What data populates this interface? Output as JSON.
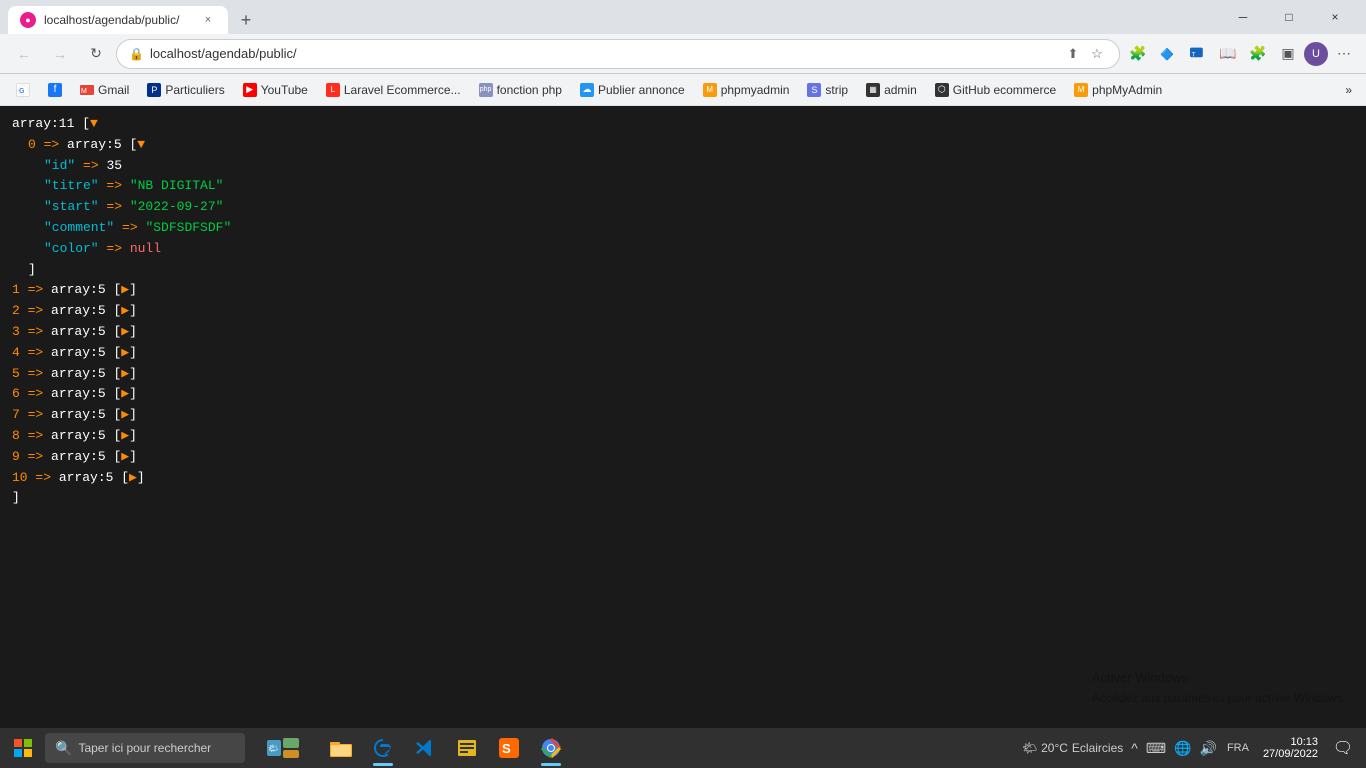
{
  "browser": {
    "tab": {
      "favicon": "●",
      "title": "localhost/agendab/public/",
      "close": "×"
    },
    "new_tab": "+",
    "window_controls": {
      "minimize": "─",
      "maximize": "□",
      "close": "×"
    },
    "nav": {
      "back": "←",
      "forward": "→",
      "reload": "↻",
      "url": "localhost/agendab/public/",
      "lock_icon": "🔒"
    },
    "bookmarks": [
      {
        "label": "G",
        "text": "",
        "style": "bm-google"
      },
      {
        "label": "f",
        "text": "",
        "style": "bm-facebook"
      },
      {
        "label": "M",
        "text": "Gmail",
        "style": "bm-gmail"
      },
      {
        "label": "P",
        "text": "Particuliers",
        "style": "bm-paypal"
      },
      {
        "label": "▶",
        "text": "YouTube",
        "style": "bm-youtube"
      },
      {
        "label": "L",
        "text": "Laravel Ecommerce...",
        "style": "bm-laravel"
      },
      {
        "label": "P",
        "text": "fonction php",
        "style": "bm-php"
      },
      {
        "label": "☁",
        "text": "Publier annonce",
        "style": "bm-publier"
      },
      {
        "label": "M",
        "text": "phpmyadmin",
        "style": "bm-phpmyadmin"
      },
      {
        "label": "S",
        "text": "strip",
        "style": "bm-stripe"
      },
      {
        "label": "A",
        "text": "admin",
        "style": "bm-admin"
      },
      {
        "label": "⬡",
        "text": "GitHub ecommerce",
        "style": "bm-github"
      },
      {
        "label": "M",
        "text": "phpMyAdmin",
        "style": "bm-phpmyadmin2"
      }
    ],
    "more": "»"
  },
  "code": {
    "lines": [
      {
        "type": "header",
        "text": "array:11 [▼"
      },
      {
        "type": "expanded",
        "indent": 2,
        "key": "0",
        "value": "array:5 [▼"
      },
      {
        "type": "property",
        "indent": 4,
        "key": "\"id\"",
        "arrow": "=>",
        "value": "35",
        "valueType": "number"
      },
      {
        "type": "property",
        "indent": 4,
        "key": "\"titre\"",
        "arrow": "=>",
        "value": "\"NB DIGITAL\"",
        "valueType": "string"
      },
      {
        "type": "property",
        "indent": 4,
        "key": "\"start\"",
        "arrow": "=>",
        "value": "\"2022-09-27\"",
        "valueType": "string"
      },
      {
        "type": "property",
        "indent": 4,
        "key": "\"comment\"",
        "arrow": "=>",
        "value": "\"SDFSDFSDF\"",
        "valueType": "string"
      },
      {
        "type": "property",
        "indent": 4,
        "key": "\"color\"",
        "arrow": "=>",
        "value": "null",
        "valueType": "null"
      },
      {
        "type": "close",
        "indent": 2,
        "text": "]"
      },
      {
        "type": "collapsed",
        "indent": 0,
        "key": "1",
        "label": "array:5 [▶]"
      },
      {
        "type": "collapsed",
        "indent": 0,
        "key": "2",
        "label": "array:5 [▶]"
      },
      {
        "type": "collapsed",
        "indent": 0,
        "key": "3",
        "label": "array:5 [▶]"
      },
      {
        "type": "collapsed",
        "indent": 0,
        "key": "4",
        "label": "array:5 [▶]"
      },
      {
        "type": "collapsed",
        "indent": 0,
        "key": "5",
        "label": "array:5 [▶]"
      },
      {
        "type": "collapsed",
        "indent": 0,
        "key": "6",
        "label": "array:5 [▶]"
      },
      {
        "type": "collapsed",
        "indent": 0,
        "key": "7",
        "label": "array:5 [▶]"
      },
      {
        "type": "collapsed",
        "indent": 0,
        "key": "8",
        "label": "array:5 [▶]"
      },
      {
        "type": "collapsed",
        "indent": 0,
        "key": "9",
        "label": "array:5 [▶]"
      },
      {
        "type": "collapsed",
        "indent": 0,
        "key": "10",
        "label": "array:5 [▶]"
      },
      {
        "type": "close_root",
        "text": "]"
      }
    ]
  },
  "watermark": {
    "line1": "Activer Windows",
    "line2": "Accédez aux paramètres pour activer Windows."
  },
  "taskbar": {
    "search_placeholder": "Taper ici pour rechercher",
    "time": "10:13",
    "date": "27/09/2022",
    "language": "FRA",
    "temperature": "20°C",
    "weather": "Eclaircies"
  }
}
